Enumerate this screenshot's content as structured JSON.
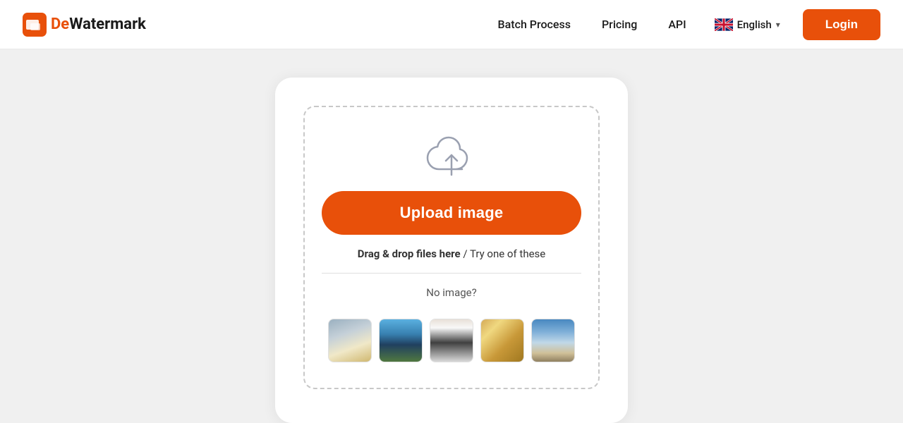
{
  "header": {
    "logo": {
      "de": "De",
      "watermark": "Watermark"
    },
    "nav": {
      "batch_process": "Batch Process",
      "pricing": "Pricing",
      "api": "API"
    },
    "language": {
      "label": "English",
      "flag_alt": "UK Flag"
    },
    "login_label": "Login"
  },
  "main": {
    "upload_button": "Upload image",
    "drag_text_bold": "Drag & drop files here",
    "drag_text_regular": " / Try one of these",
    "no_image_label": "No image?",
    "sample_images": [
      {
        "id": "thumb-1",
        "alt": "Building sample"
      },
      {
        "id": "thumb-2",
        "alt": "Lake sample"
      },
      {
        "id": "thumb-3",
        "alt": "Person sample"
      },
      {
        "id": "thumb-4",
        "alt": "Desert sample"
      },
      {
        "id": "thumb-5",
        "alt": "Sky sample"
      }
    ]
  }
}
